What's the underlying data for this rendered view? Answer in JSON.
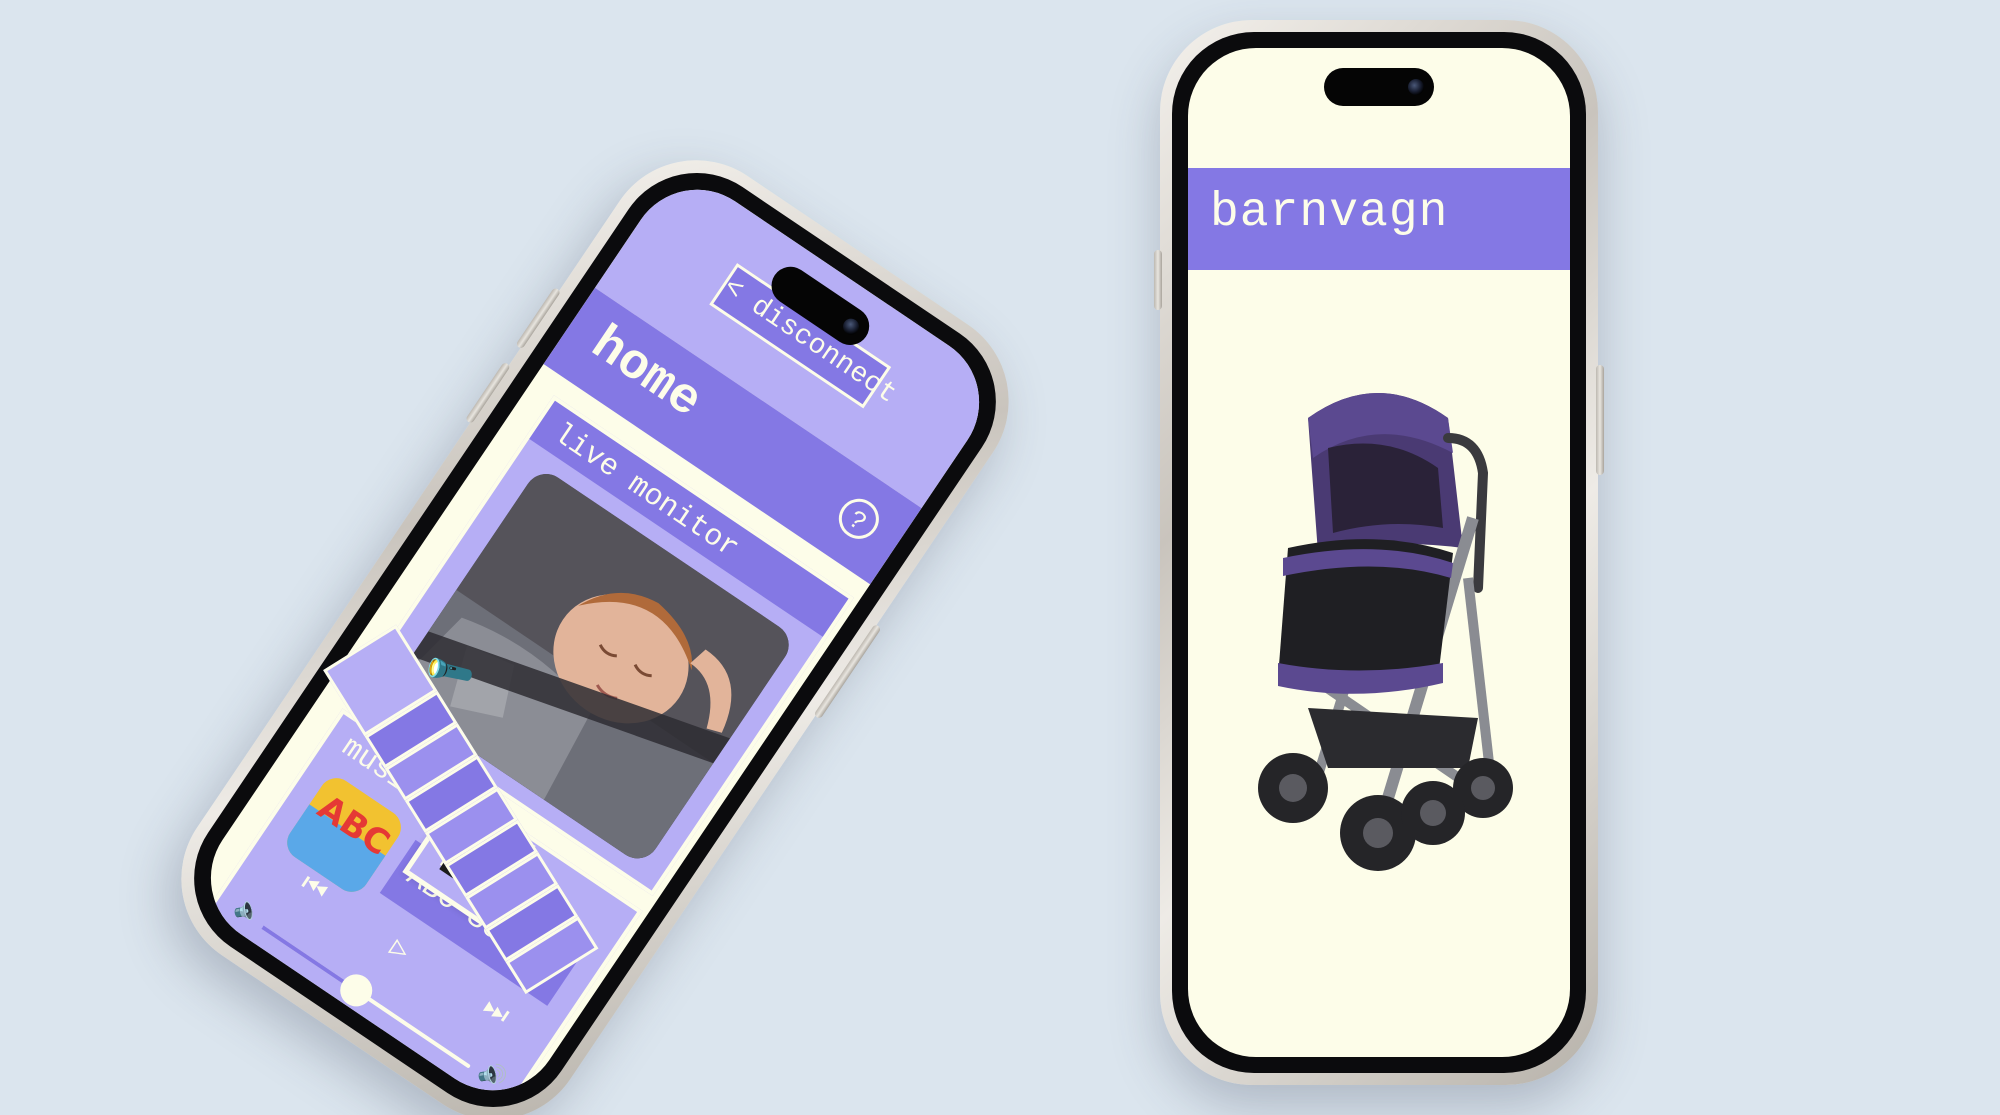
{
  "left_phone": {
    "disconnect_label": "< disconnect",
    "home_title": "home",
    "help_icon": "?",
    "live_monitor": {
      "label": "live monitor"
    },
    "music": {
      "label": "music",
      "song_title": "ABC Song",
      "album_art_text": "ABC",
      "volume_level": 0.45
    },
    "brightness_levels": 8,
    "lock_icon": "lock-icon",
    "flashlight_icon": "flashlight-icon"
  },
  "right_phone": {
    "title": "barnvagn"
  },
  "colors": {
    "background": "#dbe5ee",
    "screen": "#fdfde9",
    "accent": "#8478e4",
    "accent_light": "#b6aef5"
  }
}
